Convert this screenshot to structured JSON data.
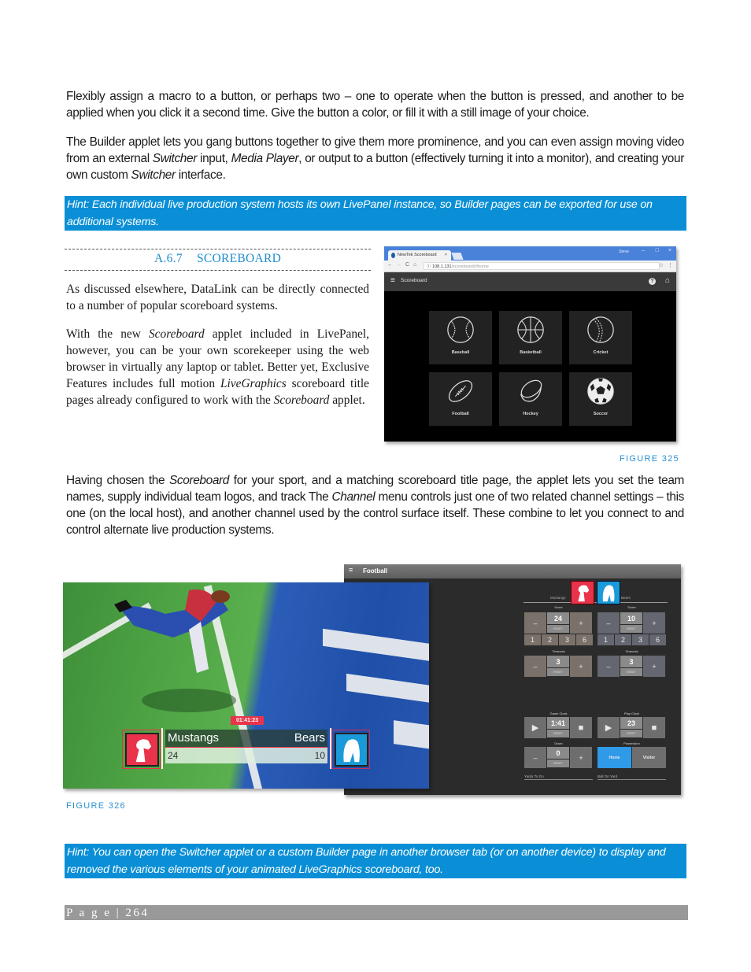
{
  "intro": {
    "p1": "Flexibly assign a macro to a button, or perhaps two – one to operate when the button is pressed, and another to be applied when you click it a second time.  Give the button a color, or fill it with a still image of your choice.",
    "p2_a": "The Builder applet lets you gang buttons together to give them more prominence, and you can even assign moving video from an external ",
    "p2_switcher": "Switcher",
    "p2_b": " input, ",
    "p2_media": "Media Player",
    "p2_c": ", or output to a button (effectively turning it into a monitor), and creating your own custom ",
    "p2_switcher2": "Switcher",
    "p2_d": " interface."
  },
  "hint1": "Hint: Each individual live production system hosts its own LivePanel instance, so Builder pages can be exported for use on additional systems.",
  "section": {
    "number": "A.6.7",
    "title": "SCOREBOARD"
  },
  "column": {
    "p1": "As discussed elsewhere, DataLink can be directly connected to a number of popular scoreboard systems.",
    "p2_a": "With the new ",
    "p2_scoreboard": "Scoreboard",
    "p2_b": " applet included in LivePanel, however, you can be your own scorekeeper using the web browser in virtually any laptop or tablet. Better yet, Exclusive Features includes full motion ",
    "p2_livegraphics": "LiveGraphics",
    "p2_c": " scoreboard title pages already configured to work with the ",
    "p2_scoreboard2": "Scoreboard",
    "p2_d": " applet."
  },
  "figure325": {
    "caption": "FIGURE 325",
    "browser": {
      "tab_title": "NewTek Scoreboard",
      "tab_close": "×",
      "user": "Steve",
      "min": "–",
      "max": "□",
      "close": "×",
      "url_host": "108.1.131",
      "url_path": "/scoreboard/#home",
      "back": "←",
      "forward": "→",
      "reload": "C",
      "home": "⌂",
      "info": "ⓘ",
      "star": "☆",
      "kebab": "⋮",
      "app_menu": "≡",
      "app_title": "Scoreboard",
      "help": "?",
      "app_home": "⌂"
    },
    "sports": [
      "Baseball",
      "Basketball",
      "Cricket",
      "Football",
      "Hockey",
      "Soccer"
    ]
  },
  "body2": {
    "a": "Having chosen the ",
    "scoreboard": "Scoreboard",
    "b": " for your sport, and a matching scoreboard title page, the applet lets you set the team names, supply individual team logos, and track The ",
    "channel": "Channel",
    "c": " menu controls just one of two related channel settings – this one (on the local host), and another channel used by the control surface itself.  These combine to let you connect to and control alternate live production systems."
  },
  "figure326": {
    "caption": "FIGURE 326",
    "overlay": {
      "clock": "01:41:23",
      "home_team": "Mustangs",
      "away_team": "Bears",
      "home_score": "24",
      "away_score": "10"
    },
    "panel": {
      "menu": "≡",
      "title": "Football",
      "home_team": "Mustangs",
      "away_team": "Bears",
      "score_label": "Score",
      "timeouts_label": "Timeouts",
      "reset": "RESET",
      "minus": "–",
      "plus": "+",
      "home_score": "24",
      "away_score": "10",
      "points": [
        "1",
        "2",
        "3",
        "6"
      ],
      "home_timeouts": "3",
      "away_timeouts": "3",
      "game_clock_label": "Game Clock",
      "game_clock": "1:41",
      "play_clock_label": "Play Clock",
      "play_clock": "23",
      "down_label": "Down",
      "down": "0",
      "possession_label": "Possession",
      "possession_home": "Home",
      "possession_visitor": "Visitor",
      "yards_to_go_label": "Yards To Go",
      "ball_on_yard_label": "Ball On Yard",
      "play": "▶",
      "stop": "■"
    }
  },
  "hint2": "Hint: You can open the Switcher applet or a custom Builder page in another browser tab (or on another device) to display and removed the various elements of your animated LiveGraphics scoreboard, too.",
  "footer": {
    "page_label": "P a g e",
    "separator": "|",
    "page_number": "264"
  },
  "colors": {
    "hint_bg": "#0a8fd6",
    "heading": "#1e8ccf",
    "caption": "#2a8fd0",
    "footer_bg": "#999999",
    "home_red": "#e8334a",
    "away_blue": "#1a9ad8",
    "possession_active": "#2f9ae8"
  }
}
